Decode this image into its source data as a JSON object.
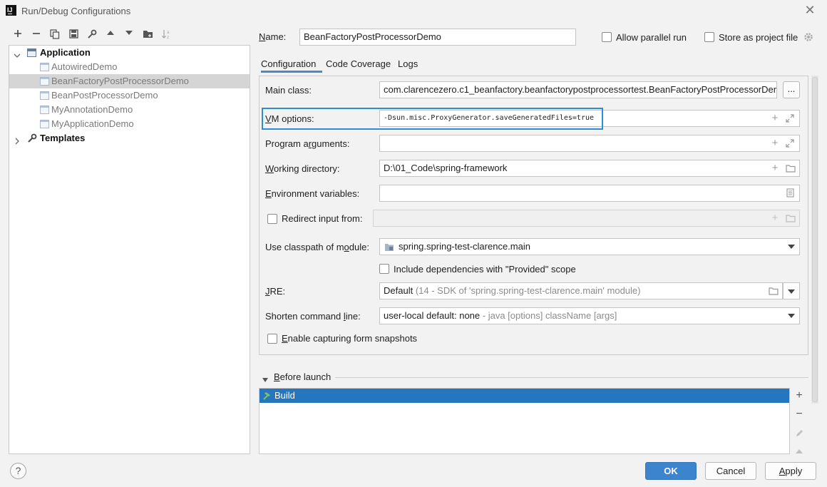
{
  "window": {
    "title": "Run/Debug Configurations"
  },
  "toolbar": {
    "icons": [
      "add-icon",
      "remove-icon",
      "copy-icon",
      "save-icon",
      "wrench-icon",
      "move-up-icon",
      "move-down-icon",
      "folder-icon",
      "sort-icon"
    ]
  },
  "tree": {
    "application": "Application",
    "items": [
      "AutowiredDemo",
      "BeanFactoryPostProcessorDemo",
      "BeanPostProcessorDemo",
      "MyAnnotationDemo",
      "MyApplicationDemo"
    ],
    "templates": "Templates"
  },
  "header": {
    "name_label": "Name:",
    "name_value": "BeanFactoryPostProcessorDemo",
    "allow_parallel": "Allow parallel run",
    "store_project": "Store as project file"
  },
  "tabs": [
    "Configuration",
    "Code Coverage",
    "Logs"
  ],
  "config": {
    "main_class_label": "Main class:",
    "main_class_value": "com.clarencezero.c1_beanfactory.beanfactorypostprocessortest.BeanFactoryPostProcessorDer",
    "browse": "...",
    "vm_label": "VM options:",
    "vm_value": "-Dsun.misc.ProxyGenerator.saveGeneratedFiles=true",
    "program_label": "Program arguments:",
    "program_value": "",
    "workdir_label": "Working directory:",
    "workdir_value": "D:\\01_Code\\spring-framework",
    "env_label": "Environment variables:",
    "env_value": "",
    "redirect_label": "Redirect input from:",
    "classpath_label": "Use classpath of module:",
    "classpath_value": "spring.spring-test-clarence.main",
    "include_label": "Include dependencies with \"Provided\" scope",
    "jre_label": "JRE:",
    "jre_value": "Default",
    "jre_hint": "(14 - SDK of 'spring.spring-test-clarence.main' module)",
    "shorten_label": "Shorten command line:",
    "shorten_value": "user-local default: none",
    "shorten_hint": "- java [options] className [args]",
    "snapshots_label": "Enable capturing form snapshots"
  },
  "before_launch": {
    "title": "Before launch",
    "items": [
      "Build"
    ]
  },
  "buttons": {
    "help": "?",
    "ok": "OK",
    "cancel": "Cancel",
    "apply": "Apply"
  },
  "colors": {
    "accent": "#2675bf",
    "highlight_border": "#2f8ed1",
    "ok_button": "#3d84cf"
  }
}
